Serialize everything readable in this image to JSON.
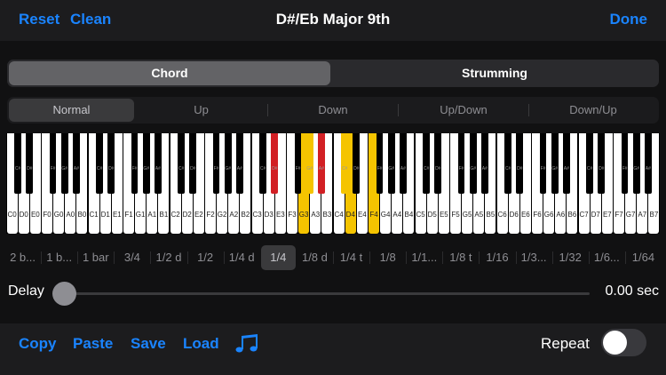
{
  "header": {
    "reset": "Reset",
    "clean": "Clean",
    "title": "D#/Eb Major 9th",
    "done": "Done"
  },
  "mode_tabs": [
    {
      "label": "Chord",
      "active": true
    },
    {
      "label": "Strumming",
      "active": false
    }
  ],
  "direction_tabs": [
    {
      "label": "Normal",
      "active": true
    },
    {
      "label": "Up",
      "active": false
    },
    {
      "label": "Down",
      "active": false
    },
    {
      "label": "Up/Down",
      "active": false
    },
    {
      "label": "Down/Up",
      "active": false
    }
  ],
  "keyboard": {
    "white_keys": [
      "C0",
      "D0",
      "E0",
      "F0",
      "G0",
      "A0",
      "B0",
      "C1",
      "D1",
      "E1",
      "F1",
      "G1",
      "A1",
      "B1",
      "C2",
      "D2",
      "E2",
      "F2",
      "G2",
      "A2",
      "B2",
      "C3",
      "D3",
      "E3",
      "F3",
      "G3",
      "A3",
      "B3",
      "C4",
      "D4",
      "E4",
      "F4",
      "G4",
      "A4",
      "B4",
      "C5",
      "D5",
      "E5",
      "F5",
      "G5",
      "A5",
      "B5",
      "C6",
      "D6",
      "E6",
      "F6",
      "G6",
      "A6",
      "B6",
      "C7",
      "D7",
      "E7",
      "F7",
      "G7",
      "A7",
      "B7"
    ],
    "black_labels": [
      "C#",
      "D#",
      "F#",
      "G#",
      "A#"
    ],
    "highlighted_white": [
      "G3",
      "D4",
      "F4"
    ],
    "highlighted_black_red": [
      "D#3",
      "A#3"
    ],
    "highlighted_black_yellow": [
      "G#3",
      "C#4"
    ],
    "highlight_colors": {
      "root": "#d21f24",
      "chord": "#f5c400"
    }
  },
  "timing_tabs": [
    {
      "label": "2 b...",
      "active": false
    },
    {
      "label": "1 b...",
      "active": false
    },
    {
      "label": "1 bar",
      "active": false
    },
    {
      "label": "3/4",
      "active": false
    },
    {
      "label": "1/2 d",
      "active": false
    },
    {
      "label": "1/2",
      "active": false
    },
    {
      "label": "1/4 d",
      "active": false
    },
    {
      "label": "1/4",
      "active": true
    },
    {
      "label": "1/8 d",
      "active": false
    },
    {
      "label": "1/4 t",
      "active": false
    },
    {
      "label": "1/8",
      "active": false
    },
    {
      "label": "1/1...",
      "active": false
    },
    {
      "label": "1/8 t",
      "active": false
    },
    {
      "label": "1/16",
      "active": false
    },
    {
      "label": "1/3...",
      "active": false
    },
    {
      "label": "1/32",
      "active": false
    },
    {
      "label": "1/6...",
      "active": false
    },
    {
      "label": "1/64",
      "active": false
    }
  ],
  "delay": {
    "label": "Delay",
    "value": "0.00 sec",
    "level": 0
  },
  "footer": {
    "copy": "Copy",
    "paste": "Paste",
    "save": "Save",
    "load": "Load",
    "notes_icon": "music-notes-icon",
    "repeat": "Repeat",
    "repeat_on": false
  },
  "colors": {
    "accent": "#1a84ff"
  }
}
